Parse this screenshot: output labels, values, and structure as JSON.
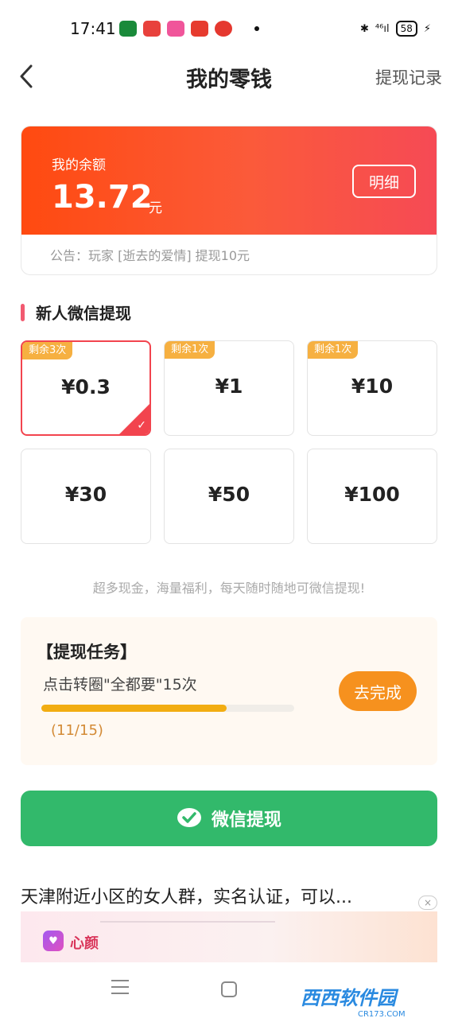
{
  "status_bar": {
    "time": "17:41",
    "network": "⁴⁶ıl",
    "battery": "58"
  },
  "header": {
    "title": "我的零钱",
    "record_link": "提现记录"
  },
  "balance": {
    "label": "我的余额",
    "value": "13.72",
    "unit": "元",
    "detail_button": "明细",
    "notice": "公告：玩家 [逝去的爱情] 提现10元"
  },
  "section": {
    "title": "新人微信提现",
    "accent_color": "#f25a70"
  },
  "amounts": [
    {
      "value": "¥0.3",
      "tag": "剩余3次",
      "selected": true
    },
    {
      "value": "¥1",
      "tag": "剩余1次",
      "selected": false
    },
    {
      "value": "¥10",
      "tag": "剩余1次",
      "selected": false
    },
    {
      "value": "¥30",
      "tag": "",
      "selected": false
    },
    {
      "value": "¥50",
      "tag": "",
      "selected": false
    },
    {
      "value": "¥100",
      "tag": "",
      "selected": false
    }
  ],
  "tip": "超多现金，海量福利，每天随时随地可微信提现!",
  "task": {
    "title": "【提现任务】",
    "desc": "点击转圈\"全都要\"15次",
    "progress_text": "(11/15)",
    "progress_fraction": 0.733,
    "button": "去完成"
  },
  "wechat_button": {
    "label": "微信提现",
    "color": "#32b96b"
  },
  "ad": {
    "text": "天津附近小区的女人群，实名认证，可以...",
    "close": "×",
    "brand": "心颜"
  },
  "watermark": {
    "text": "西西软件园",
    "sub": "CR173.COM"
  },
  "colors": {
    "balance_gradient_start": "#ff4a10",
    "balance_gradient_end": "#f64a55",
    "selected_border": "#f2444e",
    "tag_bg": "#f6b041",
    "task_button": "#f6911e",
    "progress_fill": "#f2ad12"
  }
}
